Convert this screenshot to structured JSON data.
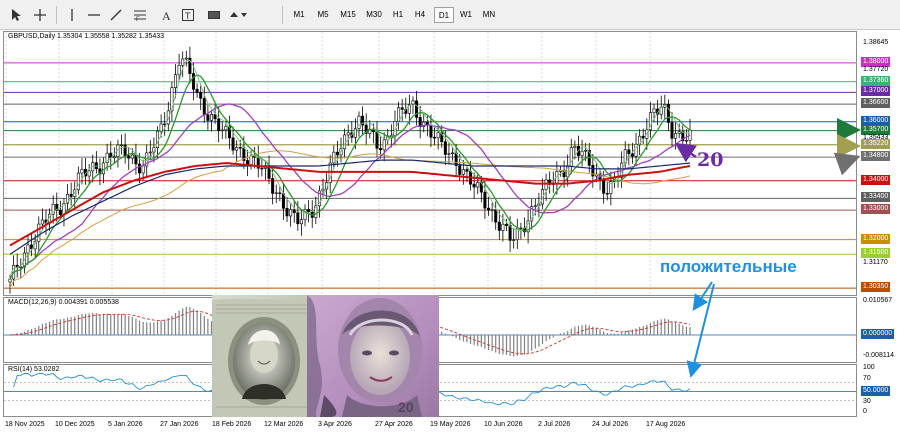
{
  "toolbar": {
    "timeframes": [
      "M1",
      "M5",
      "M15",
      "M30",
      "H1",
      "H4",
      "D1",
      "W1",
      "MN"
    ],
    "active_timeframe": "D1",
    "icons": [
      "cursor-icon",
      "crosshair-icon",
      "vertical-line-icon",
      "horizontal-line-icon",
      "trendline-icon",
      "fibonacci-icon",
      "text-icon",
      "text-label-icon",
      "rectangle-icon",
      "shapes-icon"
    ]
  },
  "price_panel": {
    "header": "GBPUSD,Daily  1.35304 1.35558 1.35282 1.35433",
    "levels": [
      {
        "label": "1.38645",
        "style": "plain",
        "color": "#000000",
        "value": 1.38645
      },
      {
        "label": "1.38000",
        "style": "boxed",
        "color": "#cc2ed0",
        "value": 1.38
      },
      {
        "label": "1.37720",
        "style": "plain",
        "color": "#000000",
        "value": 1.3772
      },
      {
        "label": "1.37360",
        "style": "boxed",
        "color": "#3cb371",
        "value": 1.3736
      },
      {
        "label": "1.37000",
        "style": "boxed",
        "color": "#6a2ba4",
        "value": 1.37
      },
      {
        "label": "1.36600",
        "style": "boxed",
        "color": "#606060",
        "value": 1.366
      },
      {
        "label": "1.36000",
        "style": "boxed",
        "color": "#1c5fa8",
        "value": 1.36
      },
      {
        "label": "1.35700",
        "style": "boxed",
        "color": "#1e7a3a",
        "value": 1.357
      },
      {
        "label": "1.35433",
        "style": "plain",
        "color": "#000000",
        "value": 1.35433
      },
      {
        "label": "1.35220",
        "style": "boxed",
        "color": "#a0a050",
        "value": 1.3522
      },
      {
        "label": "1.35220",
        "style": "boxed",
        "color": "#a0a050",
        "value": 1.3522
      },
      {
        "label": "1.34800",
        "style": "boxed",
        "color": "#707070",
        "value": 1.348
      },
      {
        "label": "1.34000",
        "style": "boxed",
        "color": "#cc1010",
        "value": 1.34
      },
      {
        "label": "1.33400",
        "style": "boxed",
        "color": "#606060",
        "value": 1.334
      },
      {
        "label": "1.33000",
        "style": "boxed",
        "color": "#a05050",
        "value": 1.33
      },
      {
        "label": "1.32000",
        "style": "boxed",
        "color": "#c89000",
        "value": 1.32
      },
      {
        "label": "1.31500",
        "style": "boxed",
        "color": "#9acd32",
        "value": 1.315
      },
      {
        "label": "1.31170",
        "style": "plain",
        "color": "#000000",
        "value": 1.3117
      },
      {
        "label": "1.30350",
        "style": "boxed",
        "color": "#b85000",
        "value": 1.3035
      }
    ],
    "annotation_number": "20",
    "annotation_text": "положительные"
  },
  "macd_panel": {
    "header": "MACD(12,26,9) 0.004391 0.005538",
    "scale": [
      "0.010567",
      "0.000000",
      "-0.008114"
    ]
  },
  "rsi_panel": {
    "header": "RSI(14) 53.0282",
    "scale": [
      "100",
      "70",
      "50.0000",
      "30",
      "0"
    ]
  },
  "time_axis": [
    "18 Nov 2025",
    "10 Dec 2025",
    "5 Jan 2026",
    "27 Jan 2026",
    "18 Feb 2026",
    "12 Mar 2026",
    "3 Apr 2026",
    "27 Apr 2026",
    "19 May 2026",
    "10 Jun 2026",
    "2 Jul 2026",
    "24 Jul 2026",
    "17 Aug 2026"
  ],
  "colors": {
    "ma_red": "#cc1010",
    "ma_green": "#2a9a2a",
    "ma_purple": "#a040c0",
    "ma_orange": "#d4a040",
    "ma_navy": "#1a2a6a",
    "macd_hist": "#808080",
    "macd_signal": "#cc3030",
    "rsi_line": "#2090d0",
    "annotation_blue": "#1e90e0",
    "annotation_purple": "#6a2ba4"
  },
  "chart_data": {
    "type": "candlestick",
    "symbol": "GBPUSD",
    "timeframe": "Daily",
    "last_ohlc": {
      "open": 1.35304,
      "high": 1.35558,
      "low": 1.35282,
      "close": 1.35433
    },
    "x_labels": [
      "18 Nov 2025",
      "10 Dec 2025",
      "5 Jan 2026",
      "27 Jan 2026",
      "18 Feb 2026",
      "12 Mar 2026",
      "3 Apr 2026",
      "27 Apr 2026",
      "19 May 2026",
      "10 Jun 2026",
      "2 Jul 2026",
      "24 Jul 2026",
      "17 Aug 2026"
    ],
    "close_path": [
      1.305,
      1.312,
      1.318,
      1.322,
      1.326,
      1.33,
      1.333,
      1.337,
      1.341,
      1.344,
      1.346,
      1.348,
      1.349,
      1.35,
      1.347,
      1.345,
      1.351,
      1.358,
      1.37,
      1.383,
      1.376,
      1.368,
      1.364,
      1.36,
      1.355,
      1.352,
      1.35,
      1.347,
      1.344,
      1.34,
      1.336,
      1.33,
      1.325,
      1.328,
      1.332,
      1.338,
      1.345,
      1.352,
      1.358,
      1.36,
      1.356,
      1.352,
      1.354,
      1.361,
      1.363,
      1.365,
      1.361,
      1.357,
      1.352,
      1.349,
      1.347,
      1.342,
      1.337,
      1.333,
      1.329,
      1.325,
      1.319,
      1.322,
      1.329,
      1.334,
      1.337,
      1.341,
      1.345,
      1.352,
      1.348,
      1.344,
      1.34,
      1.337,
      1.342,
      1.349,
      1.353,
      1.358,
      1.362,
      1.365,
      1.358,
      1.355,
      1.354
    ],
    "moving_averages": [
      {
        "name": "MA red",
        "values": [
          1.318,
          1.324,
          1.33,
          1.336,
          1.34,
          1.343,
          1.345,
          1.346,
          1.345,
          1.344,
          1.343,
          1.343,
          1.343,
          1.343,
          1.342,
          1.341,
          1.34,
          1.339,
          1.339,
          1.34,
          1.342,
          1.343,
          1.345
        ]
      },
      {
        "name": "MA navy",
        "values": [
          1.315,
          1.322,
          1.328,
          1.333,
          1.338,
          1.342,
          1.344,
          1.345,
          1.345,
          1.345,
          1.345,
          1.346,
          1.347,
          1.347,
          1.346,
          1.345,
          1.345,
          1.345,
          1.345,
          1.344,
          1.344,
          1.345,
          1.346
        ]
      }
    ],
    "rsi_last": 53.0282,
    "macd_last": {
      "main": 0.004391,
      "signal": 0.005538
    }
  }
}
